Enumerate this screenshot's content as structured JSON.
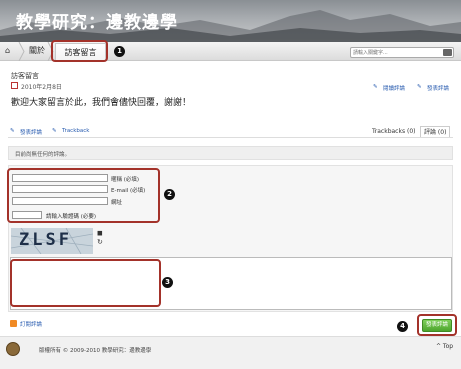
{
  "banner": {
    "title": "教學研究：邊教邊學"
  },
  "nav": {
    "about_label": "關於",
    "guestbook_label": "訪客留言",
    "search_placeholder": "請輸入關鍵字..."
  },
  "callouts": [
    "1",
    "2",
    "3",
    "4"
  ],
  "post": {
    "heading": "訪客留言",
    "date": "2010年2月8日",
    "actions": [
      "閱讀評論",
      "發表評論"
    ],
    "message": "歡迎大家留言於此，我們會儘快回覆，謝謝！"
  },
  "discussion": {
    "post_comment_label": "發表評論",
    "trackback_label": "Trackback",
    "tab_trackbacks": "Trackbacks (0)",
    "tab_comments": "評論 (0)",
    "notice": "目前尚無任何的評論。"
  },
  "form": {
    "name_label": "暱稱 (必填)",
    "email_label": "E-mail (必填)",
    "website_label": "網址",
    "captcha_label": "請輸入驗證碼 (必要)",
    "captcha_text": "ZLSF",
    "subscribe_label": "訂閱評論",
    "submit_label": "發表評論"
  },
  "footer": {
    "copyright": "版權所有 © 2009-2010 教學研究：邊教邊學",
    "top_label": "^ Top"
  },
  "colors": {
    "callout_border": "#a3322a",
    "submit_green": "#4ea52e",
    "link_blue": "#2a5db0"
  }
}
